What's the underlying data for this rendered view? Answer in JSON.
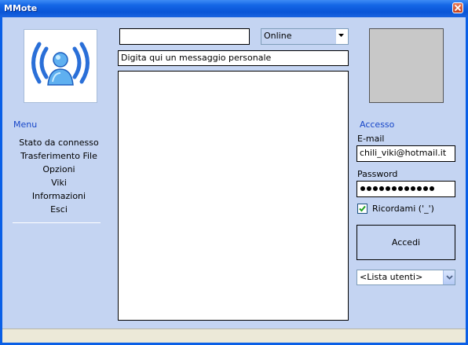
{
  "window": {
    "title": "MMote"
  },
  "menu": {
    "title": "Menu",
    "items": [
      {
        "label": "Stato da connesso"
      },
      {
        "label": "Trasferimento File"
      },
      {
        "label": "Opzioni"
      },
      {
        "label": "Viki"
      },
      {
        "label": "Informazioni"
      },
      {
        "label": "Esci"
      }
    ]
  },
  "top": {
    "name_value": "",
    "status_selected": "Online",
    "personal_message": "Digita qui un messaggio personale"
  },
  "access": {
    "title": "Accesso",
    "email_label": "E-mail",
    "email_value": "chili_viki@hotmail.it",
    "password_label": "Password",
    "password_length": 12,
    "remember_label": "Ricordami  ('_')",
    "remember_checked": true,
    "login_button": "Accedi",
    "user_list_selected": "<Lista utenti>"
  },
  "colors": {
    "title_bar": "#0a55d6",
    "client_bg": "#c4d4f2",
    "section_title": "#1746c8",
    "logo_blue": "#2a6fd8"
  },
  "icons": {
    "logo": "signal-person-icon",
    "close": "close-icon",
    "dropdown": "chevron-down-icon",
    "check": "check-icon"
  }
}
